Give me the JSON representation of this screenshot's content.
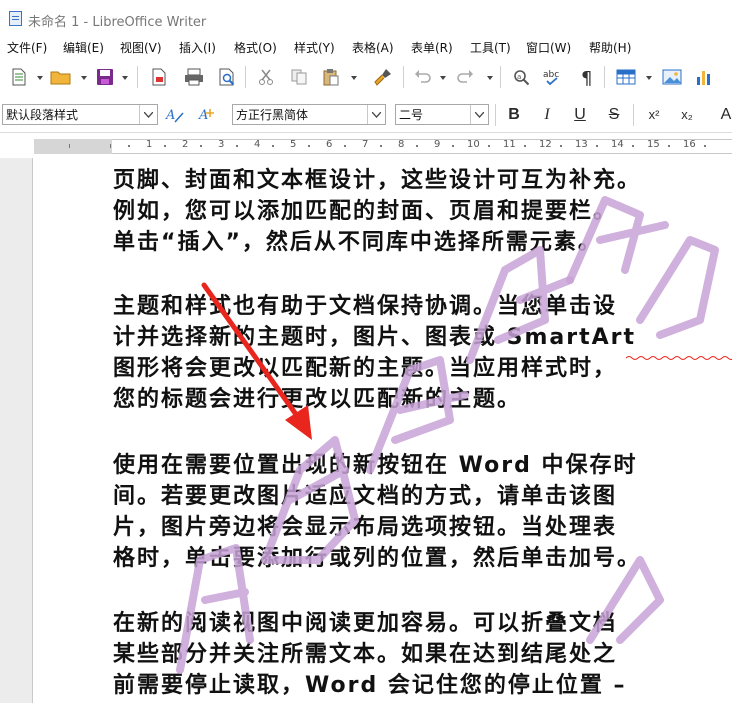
{
  "window": {
    "title": "未命名 1 - LibreOffice Writer"
  },
  "menu": {
    "items": [
      "文件(F)",
      "编辑(E)",
      "视图(V)",
      "插入(I)",
      "格式(O)",
      "样式(Y)",
      "表格(A)",
      "表单(R)",
      "工具(T)",
      "窗口(W)",
      "帮助(H)"
    ]
  },
  "toolbar": {
    "icons": [
      "new-document-icon",
      "open-folder-icon",
      "save-icon",
      "export-pdf-icon",
      "print-icon",
      "print-preview-icon",
      "cut-icon",
      "copy-icon",
      "paste-icon",
      "clone-formatting-icon",
      "undo-icon",
      "redo-icon",
      "find-replace-icon",
      "spellcheck-icon",
      "formatting-marks-icon",
      "insert-table-icon",
      "insert-image-icon",
      "insert-chart-icon"
    ]
  },
  "formatting": {
    "paragraph_style": "默认段落样式",
    "font_name": "方正行黑简体",
    "font_size": "二号",
    "bold": "B",
    "italic": "I",
    "underline": "U",
    "strikethrough": "S",
    "superscript": "x²",
    "subscript": "x₂",
    "more": "A"
  },
  "ruler": {
    "numbers": [
      "1",
      "2",
      "3",
      "4",
      "5",
      "6",
      "7",
      "8",
      "9",
      "10",
      "11",
      "12",
      "13",
      "14",
      "15",
      "16"
    ]
  },
  "document": {
    "paragraphs": [
      [
        "页脚、封面和文本框设计，这些设计可互为补充。",
        "例如，您可以添加匹配的封面、页眉和提要栏。",
        "单击“插入”，然后从不同库中选择所需元素。"
      ],
      [
        "主题和样式也有助于文档保持协调。当您单击设",
        "计并选择新的主题时，图片、图表或 SmartArt",
        "图形将会更改以匹配新的主题。当应用样式时，",
        "您的标题会进行更改以匹配新的主题。"
      ],
      [
        "使用在需要位置出现的新按钮在 Word 中保存时",
        "间。若要更改图片适应文档的方式，请单击该图",
        "片，图片旁边将会显示布局选项按钮。当处理表",
        "格时，单击要添加行或列的位置，然后单击加号。"
      ],
      [
        "在新的阅读视图中阅读更加容易。可以折叠文档",
        "某些部分并关注所需文本。如果在达到结尾处之",
        "前需要停止读取，Word 会记住您的停止位置 –"
      ]
    ]
  },
  "annotation": {
    "arrow_color": "#e8261d",
    "watermark_color": "#c8a2d6"
  }
}
